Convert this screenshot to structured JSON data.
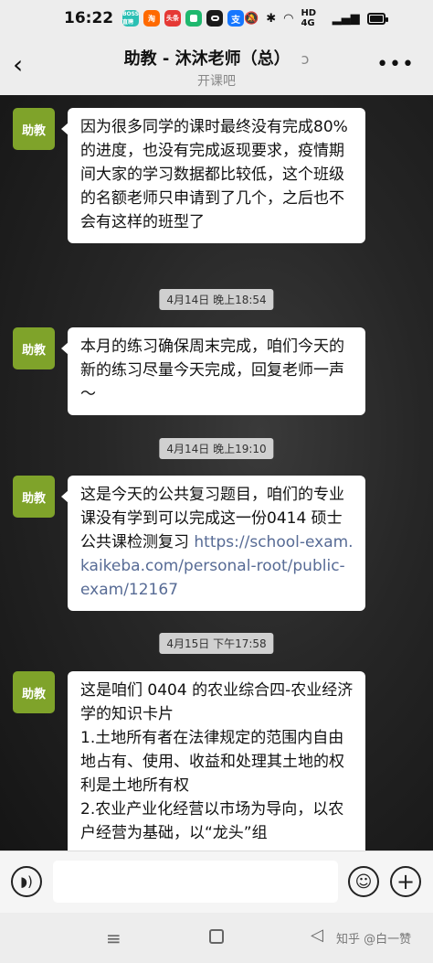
{
  "status_bar": {
    "time": "16:22",
    "app_icons": [
      {
        "label": "BOSS直聘",
        "color": "#2bc0b4"
      },
      {
        "label": "淘",
        "color": "#ff6a00"
      },
      {
        "label": "头条",
        "color": "#e53935"
      },
      {
        "label": "",
        "color": "#1fb86e"
      },
      {
        "label": "",
        "color": "#1a1a1a"
      },
      {
        "label": "支",
        "color": "#1677ff"
      }
    ],
    "signal_text": "HD 4G",
    "battery_level": 0.7
  },
  "header": {
    "title": "助教 - 沐沐老师（总）",
    "subtitle": "开课吧"
  },
  "messages": [
    {
      "sender": "助教",
      "text": "因为很多同学的课时最终没有完成80% 的进度，也没有完成返现要求，疫情期间大家的学习数据都比较低，这个班级的名额老师只申请到了几个，之后也不会有这样的班型了"
    },
    {
      "sender": "助教",
      "timestamp": "4月14日 晚上18:54",
      "text": "本月的练习确保周末完成，咱们今天的新的练习尽量今天完成，回复老师一声～"
    },
    {
      "sender": "助教",
      "timestamp": "4月14日 晚上19:10",
      "text": "这是今天的公共复习题目，咱们的专业课没有学到可以完成这一份0414 硕士公共课检测复习 ",
      "link": "https://school-exam.kaikeba.com/personal-root/public-exam/12167"
    },
    {
      "sender": "助教",
      "timestamp": "4月15日 下午17:58",
      "text": "这是咱们 0404 的农业综合四-农业经济学的知识卡片\n1.土地所有者在法律规定的范围内自由地占有、使用、收益和处理其土地的权利是土地所有权\n2.农业产业化经营以市场为导向，以农户经营为基础，以“龙头”组"
    }
  ],
  "input_bar": {
    "placeholder": ""
  },
  "watermark": "知乎 @白一赞",
  "colors": {
    "avatar": "#7fa32a",
    "link": "#576b95",
    "bubble": "#ffffff"
  }
}
